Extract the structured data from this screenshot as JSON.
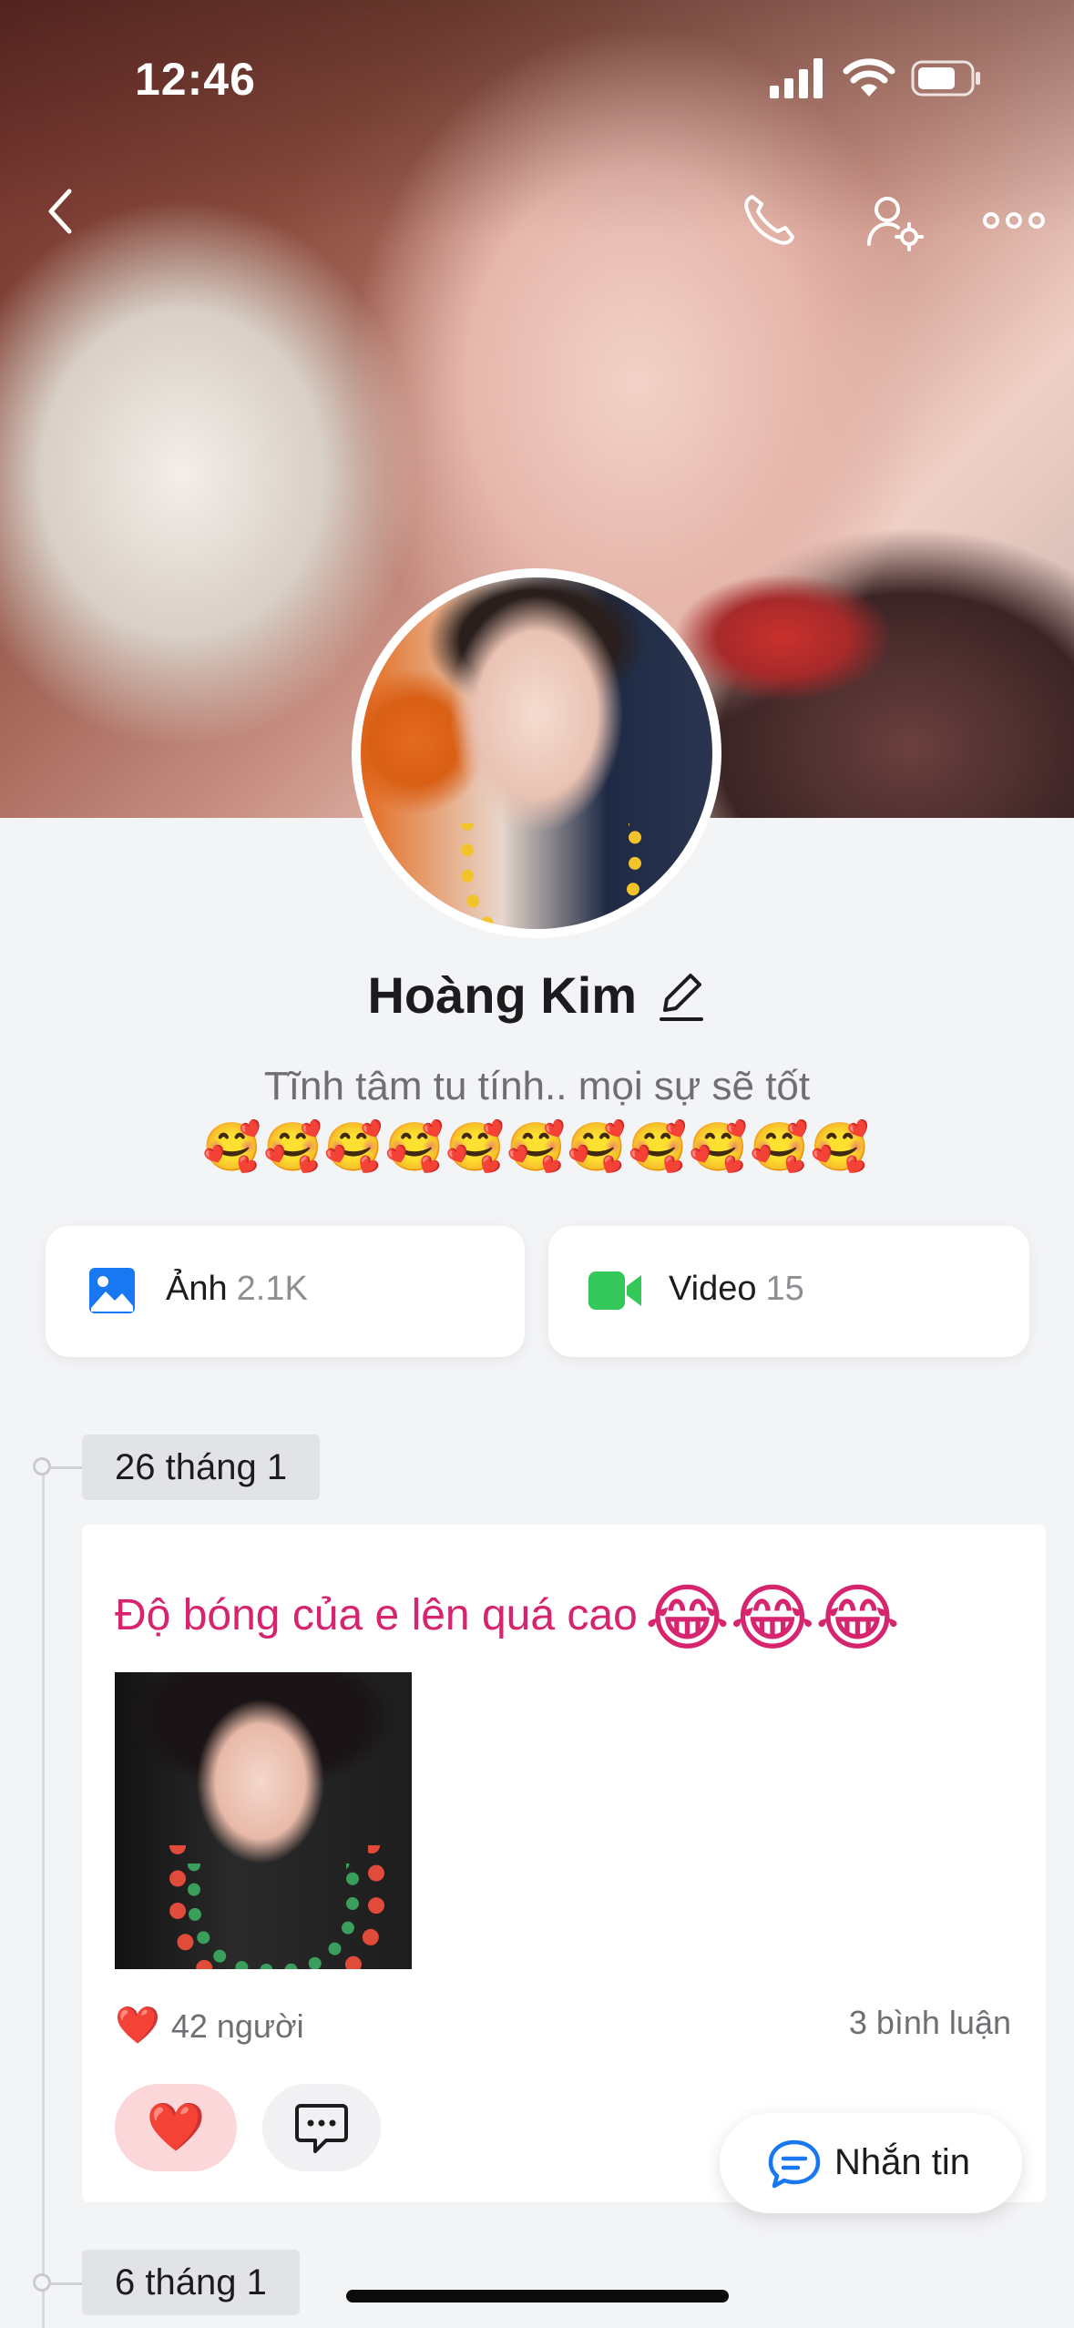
{
  "status_bar": {
    "time": "12:46"
  },
  "profile": {
    "name": "Hoàng Kim",
    "bio": "Tĩnh tâm tu tính.. mọi sự sẽ tốt",
    "emojis": "🥰🥰🥰🥰🥰🥰🥰🥰🥰🥰🥰"
  },
  "media": {
    "photos": {
      "label": "Ảnh",
      "count": "2.1K"
    },
    "videos": {
      "label": "Video",
      "count": "15"
    }
  },
  "timeline": [
    {
      "date": "26 tháng 1",
      "post_text": "Độ bóng của e lên quá cao",
      "post_emojis": "😂😂😂",
      "likes": "42 người",
      "like_emoji": "❤️",
      "comments": "3 bình luận"
    },
    {
      "date": "6 tháng 1"
    }
  ],
  "actions": {
    "message": "Nhắn tin",
    "like_button": "❤️"
  },
  "icons": {
    "back": "back-chevron-icon",
    "call": "phone-icon",
    "profile_settings": "user-settings-icon",
    "more": "more-dots-icon",
    "edit": "pencil-icon",
    "photos": "image-icon",
    "videos": "video-camera-icon",
    "comment": "comment-bubble-icon",
    "message": "chat-bubble-icon"
  },
  "colors": {
    "accent_pink": "#d6246e",
    "heart_red": "#e0243a",
    "photo_icon_blue": "#1778f2",
    "video_icon_green": "#34c759"
  }
}
